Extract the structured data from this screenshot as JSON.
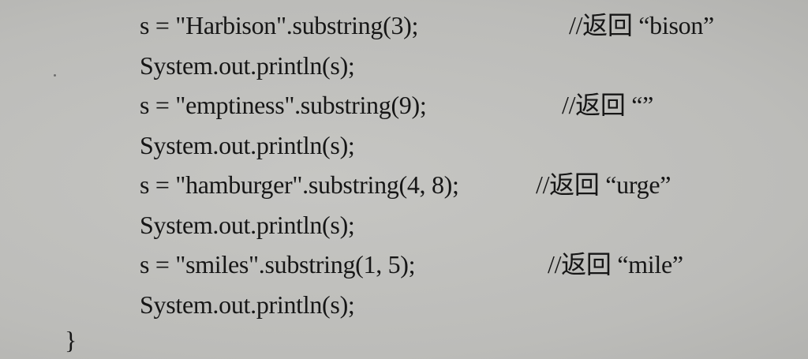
{
  "code_lines": [
    {
      "code": "s = \"Harbison\".substring(3);",
      "comment": "//返回 “bison”"
    },
    {
      "code": "System.out.println(s);",
      "comment": ""
    },
    {
      "code": "s = \"emptiness\".substring(9);",
      "comment": "//返回 “”"
    },
    {
      "code": "System.out.println(s);",
      "comment": ""
    },
    {
      "code": "s = \"hamburger\".substring(4, 8);",
      "comment": "//返回 “urge”"
    },
    {
      "code": "System.out.println(s);",
      "comment": ""
    },
    {
      "code": "s = \"smiles\".substring(1, 5);",
      "comment": "//返回 “mile”"
    },
    {
      "code": "System.out.println(s);",
      "comment": ""
    },
    {
      "code": "}",
      "comment": ""
    }
  ],
  "colors": {
    "background": "#bfbfbc",
    "text": "#161616"
  }
}
